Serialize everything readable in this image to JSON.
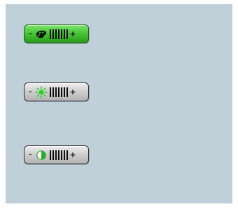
{
  "controls": [
    {
      "id": "color",
      "icon": "palette-icon",
      "minus_label": "-",
      "plus_label": "+",
      "active": true,
      "tick_count": 7
    },
    {
      "id": "brightness",
      "icon": "sun-icon",
      "minus_label": "-",
      "plus_label": "+",
      "active": false,
      "tick_count": 7
    },
    {
      "id": "contrast",
      "icon": "contrast-icon",
      "minus_label": "-",
      "plus_label": "+",
      "active": false,
      "tick_count": 7
    }
  ],
  "colors": {
    "panel_background": "#c0d0d9",
    "active_green": "#43c234",
    "inactive_gray": "#cfcfcf",
    "sun_green": "#2fd12f"
  }
}
